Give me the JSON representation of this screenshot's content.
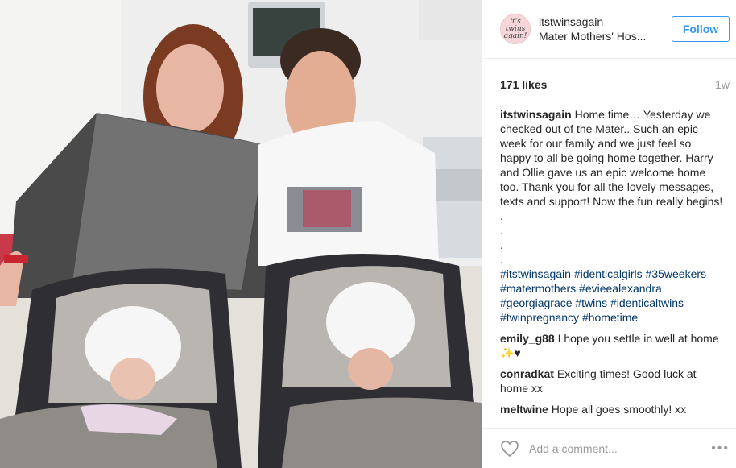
{
  "post": {
    "username": "itstwinsagain",
    "location": "Mater Mothers' Hos...",
    "follow_label": "Follow",
    "likes": "171 likes",
    "age": "1w",
    "avatar_text": "it's twins again!"
  },
  "caption": {
    "user": "itstwinsagain",
    "text": "Home time… Yesterday we checked out of the Mater.. Such an epic week for our family and we just feel so happy to all be going home together. Harry and Ollie gave us an epic welcome home too. Thank you for all the lovely messages, texts and support! Now the fun really begins! .",
    "dots": [
      ".",
      ".",
      "."
    ],
    "hashtags": "#itstwinsagain #identicalgirls #35weekers #matermothers #evieealexandra #georgiagrace #twins #identicaltwins #twinpregnancy #hometime"
  },
  "comments": [
    {
      "user": "emily_g88",
      "text": "I hope you settle in well at home ✨♥"
    },
    {
      "user": "conradkat",
      "text": "Exciting times! Good luck at home xx"
    },
    {
      "user": "meltwine",
      "text": "Hope all goes smoothly! xx"
    }
  ],
  "footer": {
    "placeholder": "Add a comment...",
    "more": "•••"
  },
  "colors": {
    "follow": "#3897f0",
    "hashtag": "#003569",
    "muted": "#999999"
  },
  "icons": [
    "heart-icon",
    "more-options-icon"
  ]
}
